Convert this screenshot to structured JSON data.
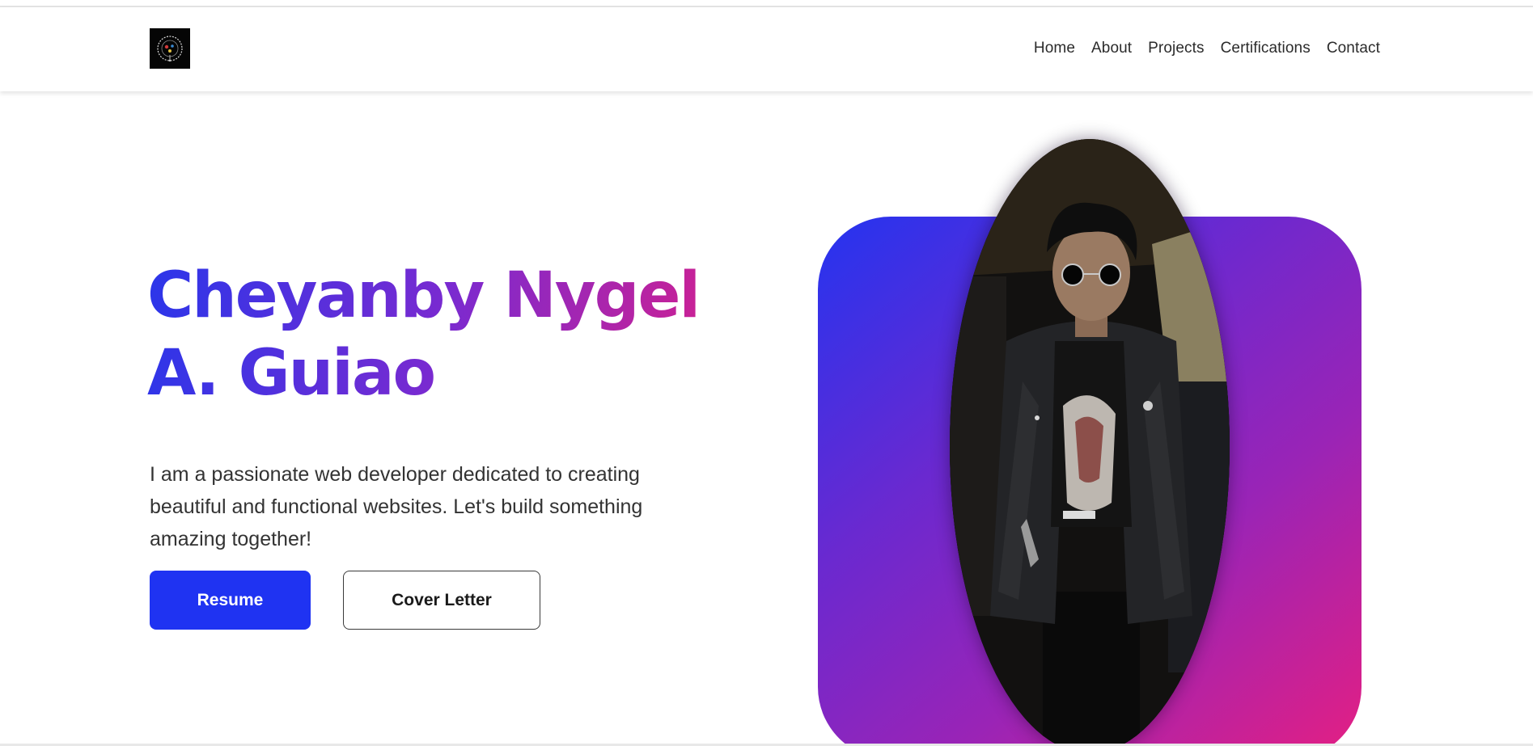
{
  "header": {
    "logo_icon": "circular-emblem-logo-icon",
    "nav": [
      {
        "label": "Home"
      },
      {
        "label": "About"
      },
      {
        "label": "Projects"
      },
      {
        "label": "Certifications"
      },
      {
        "label": "Contact"
      }
    ]
  },
  "hero": {
    "title_line1": "Cheyanby Nygel",
    "title_line2": "A. Guiao",
    "description": "I am a passionate web developer dedicated to creating beautiful and functional websites. Let's build something amazing together!",
    "resume_label": "Resume",
    "cover_letter_label": "Cover Letter",
    "profile_photo": "portrait-photo",
    "colors": {
      "title_gradient_start": "#2a36ea",
      "title_gradient_mid": "#7a2ad0",
      "title_gradient_end": "#e11f84",
      "primary_button": "#1f33f2",
      "card_gradient_start": "#2434f0",
      "card_gradient_end": "#e51f82"
    }
  }
}
